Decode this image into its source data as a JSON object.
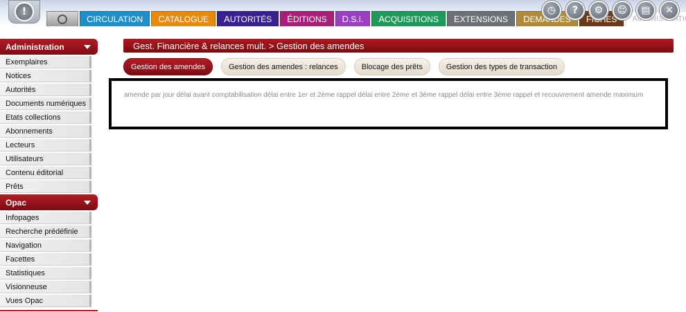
{
  "header": {
    "tabs": [
      {
        "cap": "C",
        "rest": "IRCULATION",
        "color": "#1f8fc9"
      },
      {
        "cap": "C",
        "rest": "ATALOGUE",
        "color": "#e38a0f"
      },
      {
        "cap": "A",
        "rest": "UTORITÉS",
        "color": "#3a1f8f"
      },
      {
        "cap": "É",
        "rest": "DITIONS",
        "color": "#a81f7a"
      },
      {
        "cap": "D",
        "rest": ".S.I.",
        "color": "#9a3fbf"
      },
      {
        "cap": "A",
        "rest": "CQUISITIONS",
        "color": "#1f9a5a"
      },
      {
        "cap": "E",
        "rest": "XTENSIONS",
        "color": "#6c6f74"
      },
      {
        "cap": "D",
        "rest": "EMANDES",
        "color": "#b08a3a"
      },
      {
        "cap": "F",
        "rest": "ICHES",
        "color": "#6b3a1a"
      },
      {
        "label": "ADMINISTRATION"
      }
    ],
    "icons": [
      "clock-icon",
      "help-icon",
      "settings-icon",
      "users-icon",
      "save-icon",
      "close-icon"
    ]
  },
  "sidebar": {
    "administration": {
      "title": "Administration",
      "items": [
        "Exemplaires",
        "Notices",
        "Autorités",
        "Documents numériques",
        "Etats collections",
        "Abonnements",
        "Lecteurs",
        "Utilisateurs",
        "Contenu éditorial",
        "Prêts"
      ]
    },
    "opac": {
      "title": "Opac",
      "items": [
        "Infopages",
        "Recherche prédéfinie",
        "Navigation",
        "Facettes",
        "Statistiques",
        "Visionneuse",
        "Vues Opac"
      ]
    }
  },
  "main": {
    "title": "Gest. Financière & relances mult. > Gestion des amendes",
    "subtabs": [
      "Gestion des amendes",
      "Gestion des amendes : relances",
      "Blocage des prêts",
      "Gestion des types de transaction"
    ],
    "content": "amende par jour délai avant comptabilisation délai entre 1er et 2ème rappel délai entre 2ème et 3ème rappel délai entre 3ème rappel et recouvrement amende maximum"
  }
}
